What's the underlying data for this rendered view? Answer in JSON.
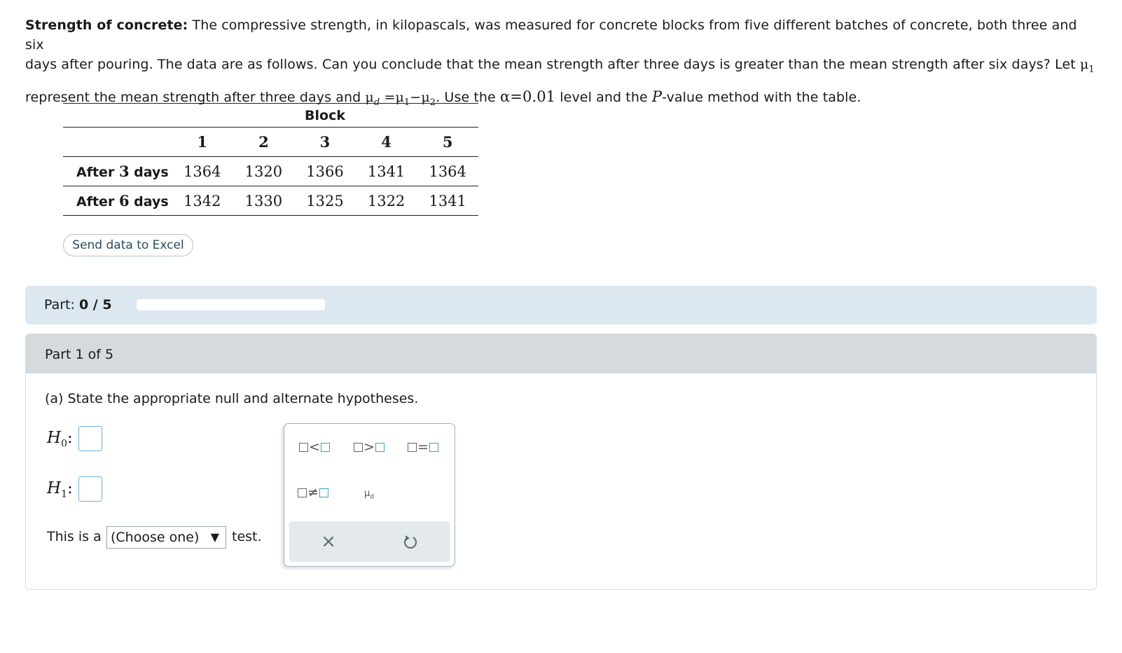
{
  "problem": {
    "title": "Strength of concrete:",
    "line1_rest": " The compressive strength, in kilopascals, was measured for concrete blocks from five different batches of concrete, both three and six",
    "line2_a": "days after pouring. The data are as follows. Can you conclude that the mean strength after three days is greater than the mean strength after six days? Let ",
    "mu": "μ",
    "sub1": "1",
    "sub2": "2",
    "subd": "d",
    "line3_a": "represent the mean strength after three days and ",
    "equals": "=",
    "minus": "−",
    "line3_b": ". Use the ",
    "alpha_expr": "α=0.01",
    "line3_c": " level and the ",
    "p": "P",
    "line3_d": "-value method with the table."
  },
  "table": {
    "group_header": "Block",
    "columns": [
      "1",
      "2",
      "3",
      "4",
      "5"
    ],
    "rows": [
      {
        "label_pre": "After ",
        "label_num": "3",
        "label_post": " days",
        "values": [
          "1364",
          "1320",
          "1366",
          "1341",
          "1364"
        ]
      },
      {
        "label_pre": "After ",
        "label_num": "6",
        "label_post": " days",
        "values": [
          "1342",
          "1330",
          "1325",
          "1322",
          "1341"
        ]
      }
    ]
  },
  "excel_button": "Send data to Excel",
  "part_progress": {
    "label": "Part: ",
    "value": "0 / 5",
    "fraction": 0
  },
  "part": {
    "header": "Part 1 of 5",
    "question": "(a) State the appropriate null and alternate hypotheses.",
    "h0_letter": "H",
    "h0_sub": "0",
    "h1_letter": "H",
    "h1_sub": "1",
    "colon": ":",
    "test_prefix": "This is a",
    "select_value": "(Choose one)",
    "test_suffix": "test."
  },
  "palette": {
    "less": "<",
    "greater": ">",
    "equal": "=",
    "not_equal": "≠",
    "mu": "μ",
    "mu_sub": "d",
    "clear_icon": "×",
    "undo_icon": "undo-icon"
  },
  "colors": {
    "progress_bar_bg": "#dde7f0",
    "part_header_bg": "#d4dadd",
    "answer_box_border": "#6bb0d4"
  }
}
